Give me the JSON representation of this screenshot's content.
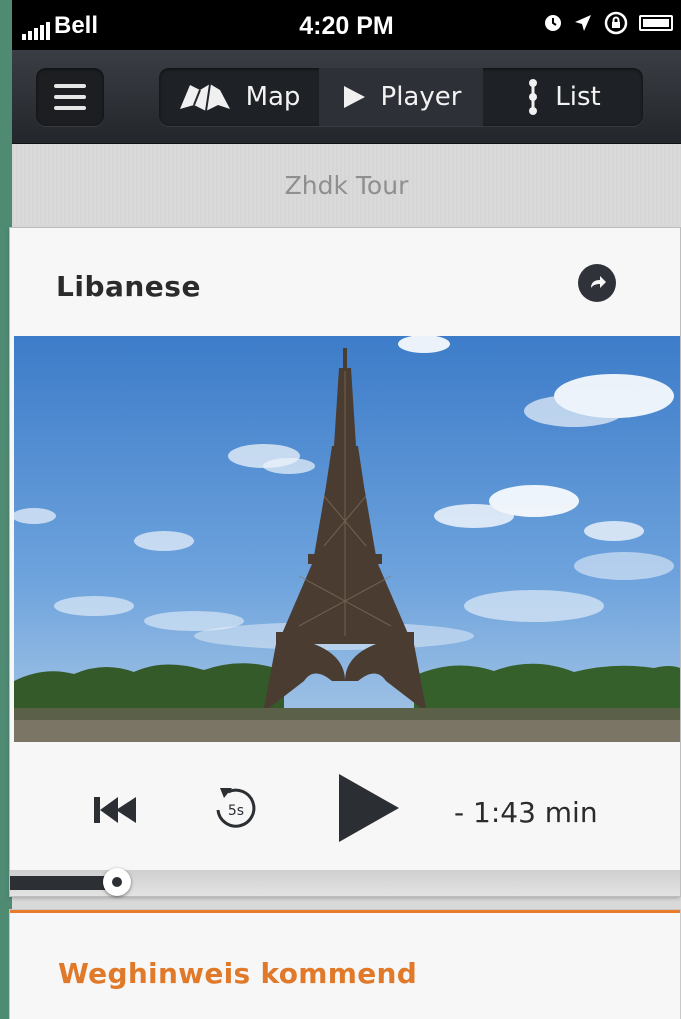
{
  "status_bar": {
    "carrier": "Bell",
    "time": "4:20 PM"
  },
  "nav": {
    "segments": [
      {
        "label": "Map",
        "icon": "map-icon"
      },
      {
        "label": "Player",
        "icon": "play-icon",
        "selected": true
      },
      {
        "label": "List",
        "icon": "list-icon"
      }
    ]
  },
  "tour": {
    "title": "Zhdk Tour"
  },
  "player": {
    "title": "Libanese",
    "skip_seconds_label": "5s",
    "remaining": "- 1:43 min",
    "progress": 0.16
  },
  "next": {
    "heading": "Weghinweis kommend"
  },
  "colors": {
    "background": "#4f8a73",
    "navbar": "#2b2e33",
    "accent": "#e07a2a",
    "text": "#2b2b2b"
  }
}
